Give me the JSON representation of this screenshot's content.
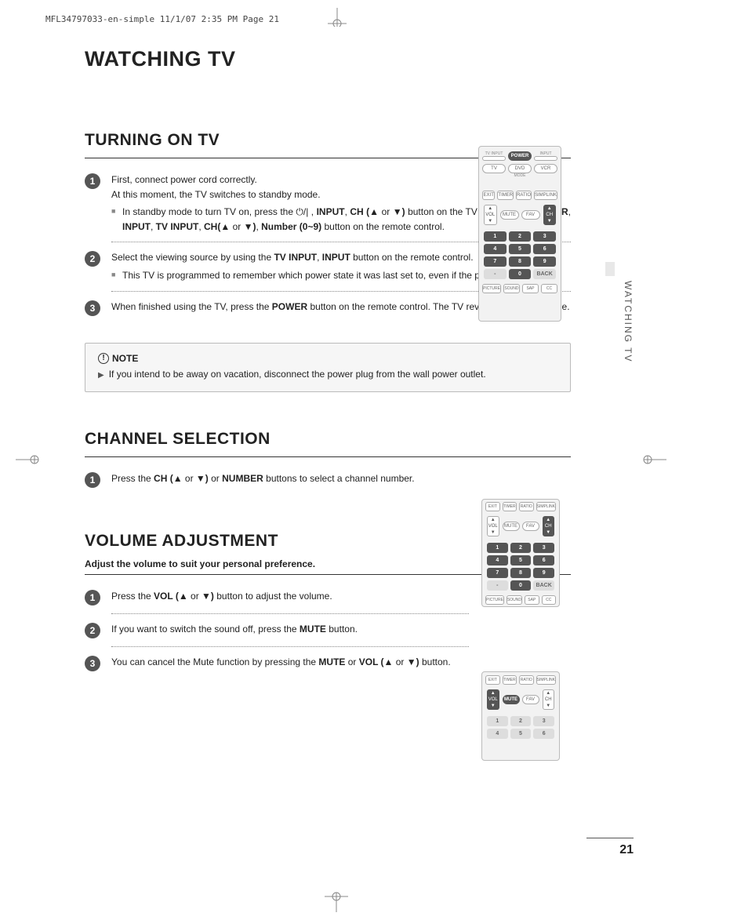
{
  "meta": {
    "crop_header": "MFL34797033-en-simple  11/1/07 2:35 PM  Page 21",
    "side_label": "WATCHING TV",
    "page_number": "21"
  },
  "page_title": "WATCHING TV",
  "turning_on": {
    "title": "TURNING ON TV",
    "steps": [
      {
        "num": "1",
        "lines": [
          "First, connect power cord correctly.",
          "At this moment, the TV switches to standby mode."
        ],
        "sub": "In standby mode to turn TV on, press the ⏻/| , INPUT, CH (▲ or ▼) button on the TV or press the POWER, INPUT, TV INPUT, CH(▲ or ▼), Number (0~9) button on the remote control."
      },
      {
        "num": "2",
        "lines": [
          "Select the viewing source by using the TV INPUT, INPUT button on the remote control."
        ],
        "sub": "This TV is programmed to remember which power state it was last set to, even if the power cord is out."
      },
      {
        "num": "3",
        "lines": [
          "When finished using the TV, press the POWER button on the remote control. The TV reverts to standby mode."
        ]
      }
    ],
    "note_title": "NOTE",
    "note_body": "If you intend to be away on vacation, disconnect the power plug from the wall power outlet."
  },
  "channel": {
    "title": "CHANNEL SELECTION",
    "step_num": "1",
    "step_text": "Press the CH (▲ or ▼) or NUMBER buttons to select a channel number."
  },
  "volume": {
    "title": "VOLUME ADJUSTMENT",
    "intro": "Adjust the volume to suit your personal preference.",
    "steps": [
      {
        "num": "1",
        "text": "Press the VOL (▲ or ▼) button to adjust the volume."
      },
      {
        "num": "2",
        "text": "If you want to switch the sound off, press the MUTE button."
      },
      {
        "num": "3",
        "text": "You can cancel the Mute function by pressing the MUTE or VOL (▲ or ▼) button."
      }
    ]
  },
  "remote": {
    "tv_input": "TV INPUT",
    "input": "INPUT",
    "power": "POWER",
    "tv": "TV",
    "dvd": "DVD",
    "vcr": "VCR",
    "mode": "MODE",
    "exit": "EXIT",
    "timer": "TIMER",
    "ratio": "RATIO",
    "simplink": "SIMPLINK",
    "vol": "VOL",
    "ch": "CH",
    "mute": "MUTE",
    "fav": "FAV",
    "back": "BACK",
    "dash": "-",
    "k1": "1",
    "k2": "2",
    "k3": "3",
    "k4": "4",
    "k5": "5",
    "k6": "6",
    "k7": "7",
    "k8": "8",
    "k9": "9",
    "k0": "0",
    "picture": "PICTURE",
    "sound": "SOUND",
    "sap": "SAP",
    "cc": "CC"
  }
}
